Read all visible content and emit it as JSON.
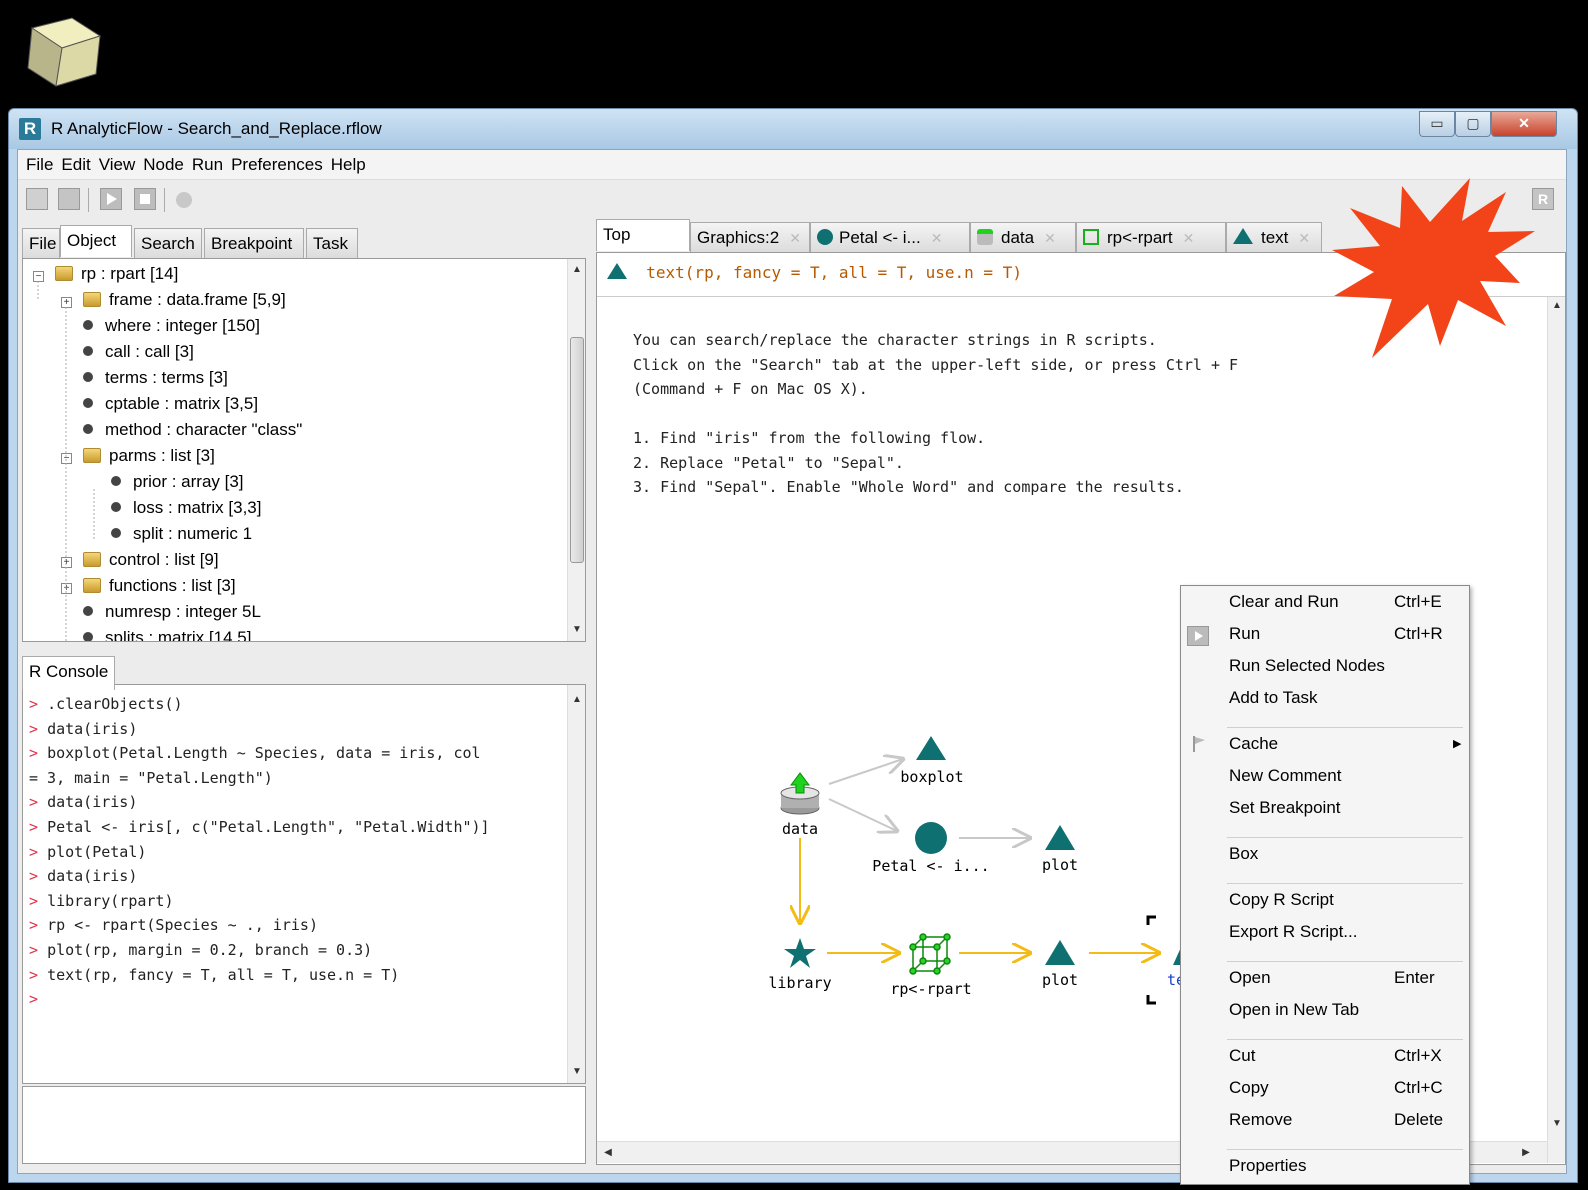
{
  "window": {
    "title": "R AnalyticFlow  -  Search_and_Replace.rflow",
    "app_icon": "R",
    "btn_min": "▭",
    "btn_max": "▢",
    "btn_close": "✕"
  },
  "menu": [
    "File",
    "Edit",
    "View",
    "Node",
    "Run",
    "Preferences",
    "Help"
  ],
  "left_tabs": [
    "File",
    "Object",
    "Search",
    "Breakpoint",
    "Task"
  ],
  "tree": [
    {
      "label": "rp : rpart [14]",
      "kind": "folder",
      "depth": 0,
      "exp": "−"
    },
    {
      "label": "frame : data.frame [5,9]",
      "kind": "folder",
      "depth": 1,
      "exp": "+"
    },
    {
      "label": "where : integer [150]",
      "kind": "leaf",
      "depth": 1
    },
    {
      "label": "call : call [3]",
      "kind": "leaf",
      "depth": 1
    },
    {
      "label": "terms : terms [3]",
      "kind": "leaf",
      "depth": 1
    },
    {
      "label": "cptable : matrix [3,5]",
      "kind": "leaf",
      "depth": 1
    },
    {
      "label": "method : character \"class\"",
      "kind": "leaf",
      "depth": 1
    },
    {
      "label": "parms : list [3]",
      "kind": "folder",
      "depth": 1,
      "exp": "−"
    },
    {
      "label": "prior : array [3]",
      "kind": "leaf",
      "depth": 2
    },
    {
      "label": "loss : matrix [3,3]",
      "kind": "leaf",
      "depth": 2
    },
    {
      "label": "split : numeric 1",
      "kind": "leaf",
      "depth": 2
    },
    {
      "label": "control : list [9]",
      "kind": "folder",
      "depth": 1,
      "exp": "+"
    },
    {
      "label": "functions : list [3]",
      "kind": "folder",
      "depth": 1,
      "exp": "+"
    },
    {
      "label": "numresp : integer 5L",
      "kind": "leaf",
      "depth": 1
    },
    {
      "label": "splits : matrix [14,5]",
      "kind": "leaf",
      "depth": 1
    }
  ],
  "console_tab": "R Console",
  "console_lines": [
    {
      "p": "> ",
      "t": ".clearObjects()"
    },
    {
      "p": "> ",
      "t": "data(iris)"
    },
    {
      "p": "> ",
      "t": "boxplot(Petal.Length ~ Species, data = iris, col"
    },
    {
      "p": "",
      "t": "= 3, main = \"Petal.Length\")"
    },
    {
      "p": "> ",
      "t": "data(iris)"
    },
    {
      "p": "> ",
      "t": "Petal <- iris[, c(\"Petal.Length\", \"Petal.Width\")]"
    },
    {
      "p": "> ",
      "t": "plot(Petal)"
    },
    {
      "p": "> ",
      "t": "data(iris)"
    },
    {
      "p": "> ",
      "t": "library(rpart)"
    },
    {
      "p": "> ",
      "t": "rp <- rpart(Species ~ ., iris)"
    },
    {
      "p": "> ",
      "t": "plot(rp, margin = 0.2, branch = 0.3)"
    },
    {
      "p": "> ",
      "t": "text(rp, fancy = T, all = T, use.n = T)"
    },
    {
      "p": ">",
      "t": ""
    }
  ],
  "main_tabs": [
    {
      "label": "Top",
      "icon": ""
    },
    {
      "label": "Graphics:2",
      "icon": ""
    },
    {
      "label": "Petal <- i...",
      "icon": "circle"
    },
    {
      "label": "data",
      "icon": "data"
    },
    {
      "label": "rp<-rpart",
      "icon": "cube"
    },
    {
      "label": "text",
      "icon": "triangle"
    }
  ],
  "close_glyph": "✕",
  "script": "text(rp, fancy = T, all = T, use.n = T)",
  "description": [
    "You can search/replace the character strings in R scripts.",
    "Click on the \"Search\" tab at the upper-left side, or press Ctrl + F",
    "(Command + F on Mac OS X).",
    "",
    "1. Find \"iris\" from the following flow.",
    "2. Replace \"Petal\" to \"Sepal\".",
    "3. Find \"Sepal\". Enable \"Whole Word\" and compare the results."
  ],
  "flow_nodes": {
    "data": "data",
    "boxplot": "boxplot",
    "petal": "Petal <- i...",
    "plot1": "plot",
    "library": "library",
    "rpart": "rp<-rpart",
    "plot2": "plot",
    "text": "te"
  },
  "context_menu": [
    {
      "label": "Clear and Run",
      "shortcut": "Ctrl+E"
    },
    {
      "label": "Run",
      "shortcut": "Ctrl+R",
      "icon": "play"
    },
    {
      "label": "Run Selected Nodes",
      "shortcut": ""
    },
    {
      "label": "Add to Task",
      "shortcut": ""
    },
    {
      "sep": true
    },
    {
      "label": "Cache",
      "shortcut": "",
      "icon": "flag",
      "submenu": true
    },
    {
      "label": "New Comment",
      "shortcut": ""
    },
    {
      "label": "Set Breakpoint",
      "shortcut": ""
    },
    {
      "sep": true
    },
    {
      "label": "Box",
      "shortcut": ""
    },
    {
      "sep": true
    },
    {
      "label": "Copy R Script",
      "shortcut": ""
    },
    {
      "label": "Export R Script...",
      "shortcut": ""
    },
    {
      "sep": true
    },
    {
      "label": "Open",
      "shortcut": "Enter"
    },
    {
      "label": "Open in New Tab",
      "shortcut": ""
    },
    {
      "sep": true
    },
    {
      "label": "Cut",
      "shortcut": "Ctrl+X"
    },
    {
      "label": "Copy",
      "shortcut": "Ctrl+C"
    },
    {
      "label": "Remove",
      "shortcut": "Delete"
    },
    {
      "sep": true
    },
    {
      "label": "Properties",
      "shortcut": ""
    }
  ],
  "colors": {
    "node": "#0e7070",
    "arrow_main": "#f2bb16",
    "arrow_light": "#c8c8c8",
    "burst": "#f24418",
    "prompt": "#e0344c"
  }
}
